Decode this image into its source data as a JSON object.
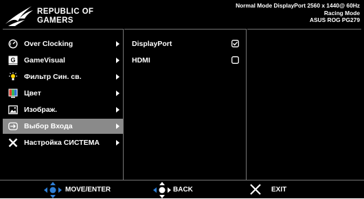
{
  "header": {
    "brand_line1": "REPUBLIC OF",
    "brand_line2": "GAMERS",
    "info_line1": "Normal Mode DisplayPort 2560 x 1440@ 60Hz",
    "info_line2": "Racing Mode",
    "info_line3": "ASUS ROG PG279"
  },
  "menu": {
    "items": [
      {
        "label": "Over Clocking",
        "icon": "gauge-icon"
      },
      {
        "label": "GameVisual",
        "icon": "gamevisual-icon"
      },
      {
        "label": "Фильтр Син. св.",
        "icon": "bluelight-icon"
      },
      {
        "label": "Цвет",
        "icon": "color-icon"
      },
      {
        "label": "Изображ.",
        "icon": "image-icon"
      },
      {
        "label": "Выбор Входа",
        "icon": "input-icon",
        "selected": true
      },
      {
        "label": "Настройка СИСТЕМА",
        "icon": "tools-icon"
      }
    ]
  },
  "submenu": {
    "items": [
      {
        "label": "DisplayPort",
        "checked": true
      },
      {
        "label": "HDMI",
        "checked": false
      }
    ]
  },
  "footer": {
    "move_label": "MOVE/ENTER",
    "back_label": "BACK",
    "exit_label": "EXIT"
  },
  "colors": {
    "background": "#000000",
    "selected_row": "#8a8a8a",
    "divider": "#777777",
    "nav_blue": "#2f7fd6"
  }
}
